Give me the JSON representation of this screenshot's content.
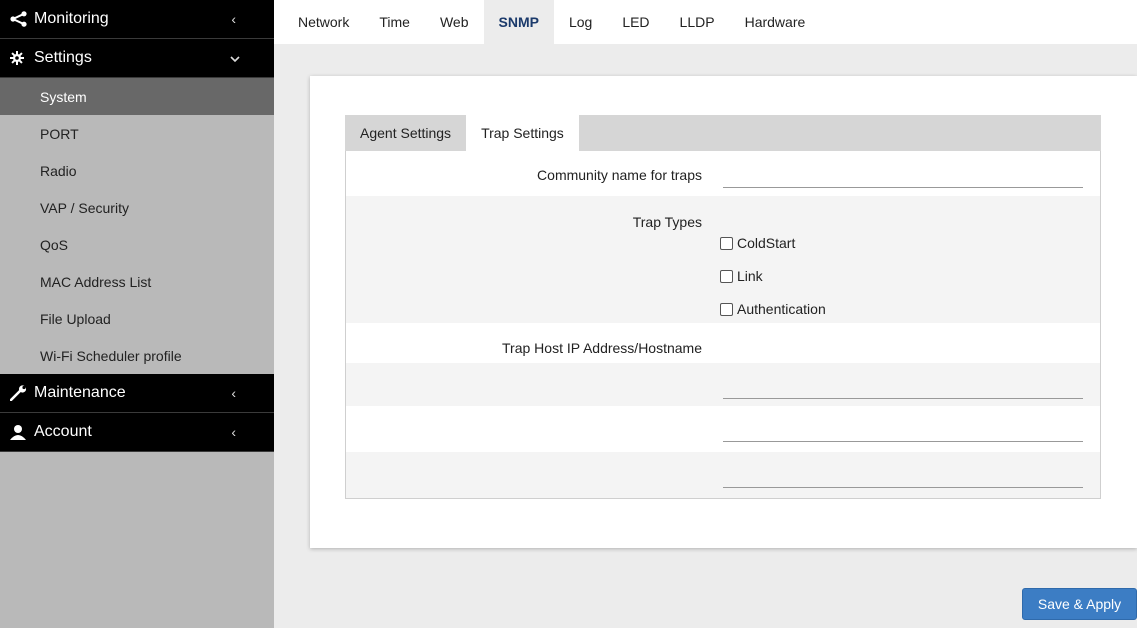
{
  "sidebar": {
    "monitoring": {
      "label": "Monitoring",
      "icon": "share-icon"
    },
    "settings": {
      "label": "Settings",
      "icon": "gear-icon",
      "items": [
        {
          "label": "System"
        },
        {
          "label": "PORT"
        },
        {
          "label": "Radio"
        },
        {
          "label": "VAP / Security"
        },
        {
          "label": "QoS"
        },
        {
          "label": "MAC Address List"
        },
        {
          "label": "File Upload"
        },
        {
          "label": "Wi-Fi Scheduler profile"
        }
      ]
    },
    "maintenance": {
      "label": "Maintenance",
      "icon": "wrench-icon"
    },
    "account": {
      "label": "Account",
      "icon": "user-icon"
    }
  },
  "top_tabs": [
    "Network",
    "Time",
    "Web",
    "SNMP",
    "Log",
    "LED",
    "LLDP",
    "Hardware"
  ],
  "sub_tabs": [
    "Agent Settings",
    "Trap Settings"
  ],
  "form": {
    "community_label": "Community name for traps",
    "community_value": "",
    "trap_types_label": "Trap Types",
    "trap_types": [
      {
        "label": "ColdStart",
        "checked": false
      },
      {
        "label": "Link",
        "checked": false
      },
      {
        "label": "Authentication",
        "checked": false
      }
    ],
    "trap_host_label": "Trap Host IP Address/Hostname",
    "trap_hosts": [
      "",
      "",
      ""
    ]
  },
  "save_label": "Save & Apply",
  "colors": {
    "sidebar_bg": "#b9b9b9",
    "active_item": "#686868",
    "header_bg": "#000000",
    "button": "#3c7dc4",
    "active_tab_text": "#1b3a6b"
  }
}
